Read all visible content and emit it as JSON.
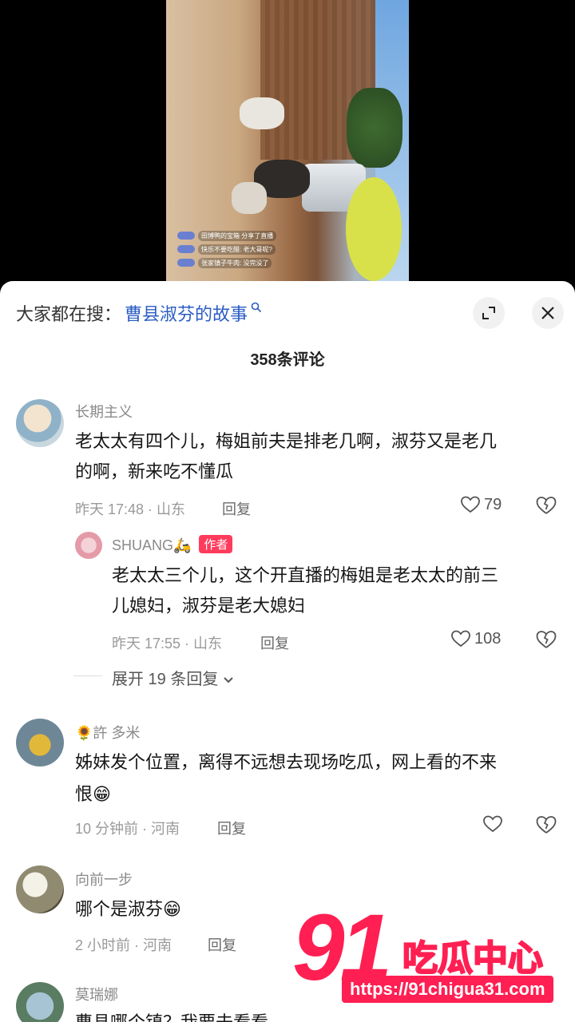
{
  "video": {
    "live_comments": [
      "田博鸭的宝箱 分享了直播",
      "快乐不要吃醋: 老大哥呢?",
      "张家镇子牛肉: 没完没了"
    ]
  },
  "sheet": {
    "search_prefix": "大家都在搜：",
    "search_term": "曹县淑芬的故事",
    "comment_count": "358条评论"
  },
  "comments": [
    {
      "username": "长期主义",
      "text_line1": "老太太有四个儿，梅姐前夫是排老几啊，淑芬又是老几",
      "text_line2": "的啊，新来吃不懂瓜",
      "meta": "昨天 17:48 · 山东",
      "reply": "回复",
      "likes": "79",
      "reply_item": {
        "username": "SHUANG🛵",
        "badge": "作者",
        "text_line1": "老太太三个儿，这个开直播的梅姐是老太太的前三",
        "text_line2": "儿媳妇，淑芬是老大媳妇",
        "meta": "昨天 17:55 · 山东",
        "reply": "回复",
        "likes": "108"
      },
      "expand": "展开 19 条回复"
    },
    {
      "username": "🌻許 多米",
      "text_line1": "姊妹发个位置，离得不远想去现场吃瓜，网上看的不来",
      "text_line2": "恨😁",
      "meta": "10 分钟前 · 河南",
      "reply": "回复"
    },
    {
      "username": "向前一步",
      "text_line1": "哪个是淑芬😁",
      "meta": "2 小时前 · 河南",
      "reply": "回复"
    },
    {
      "username": "莫瑞娜",
      "text_line1": "曹县哪个镇？我要去看看"
    }
  ],
  "watermark": {
    "number": "91",
    "brand": "吃瓜中心",
    "url": "https://91chigua31.com"
  },
  "colors": {
    "link_blue": "#2a5cc4",
    "author_badge": "#ff3b5c",
    "watermark_red": "#ff1f52"
  }
}
